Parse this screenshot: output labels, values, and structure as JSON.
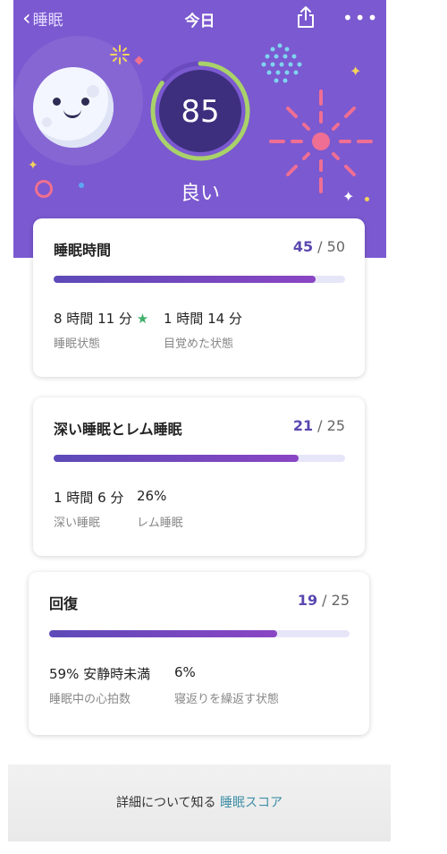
{
  "nav": {
    "back_label": "睡眠",
    "title": "今日"
  },
  "summary": {
    "score": "85",
    "score_progress": 0.85,
    "rating": "良い"
  },
  "cards": [
    {
      "title": "睡眠時間",
      "score": "45",
      "max": " / 50",
      "progress": 0.9,
      "metrics": [
        {
          "value": "8 時間 11 分",
          "label": "睡眠状態",
          "star": true
        },
        {
          "value": "1 時間 14 分",
          "label": "目覚めた状態"
        }
      ]
    },
    {
      "title": "深い睡眠とレム睡眠",
      "score": "21",
      "max": " / 25",
      "progress": 0.84,
      "metrics": [
        {
          "value": "1 時間 6 分",
          "label": "深い睡眠"
        },
        {
          "value": "26%",
          "label": "レム睡眠"
        }
      ]
    },
    {
      "title": "回復",
      "score": "19",
      "max": " / 25",
      "progress": 0.76,
      "metrics": [
        {
          "value": "59% 安静時未満",
          "label": "睡眠中の心拍数"
        },
        {
          "value": "6%",
          "label": "寝返りを繰返す状態"
        }
      ]
    }
  ],
  "footer": {
    "text": "詳細について知る",
    "link": "睡眠スコア"
  },
  "colors": {
    "header_bg": "#7b59d0",
    "accent": "#5b47b0",
    "ring": "#a9d26a",
    "star": "#3fae6a",
    "link": "#3f8fa6"
  }
}
